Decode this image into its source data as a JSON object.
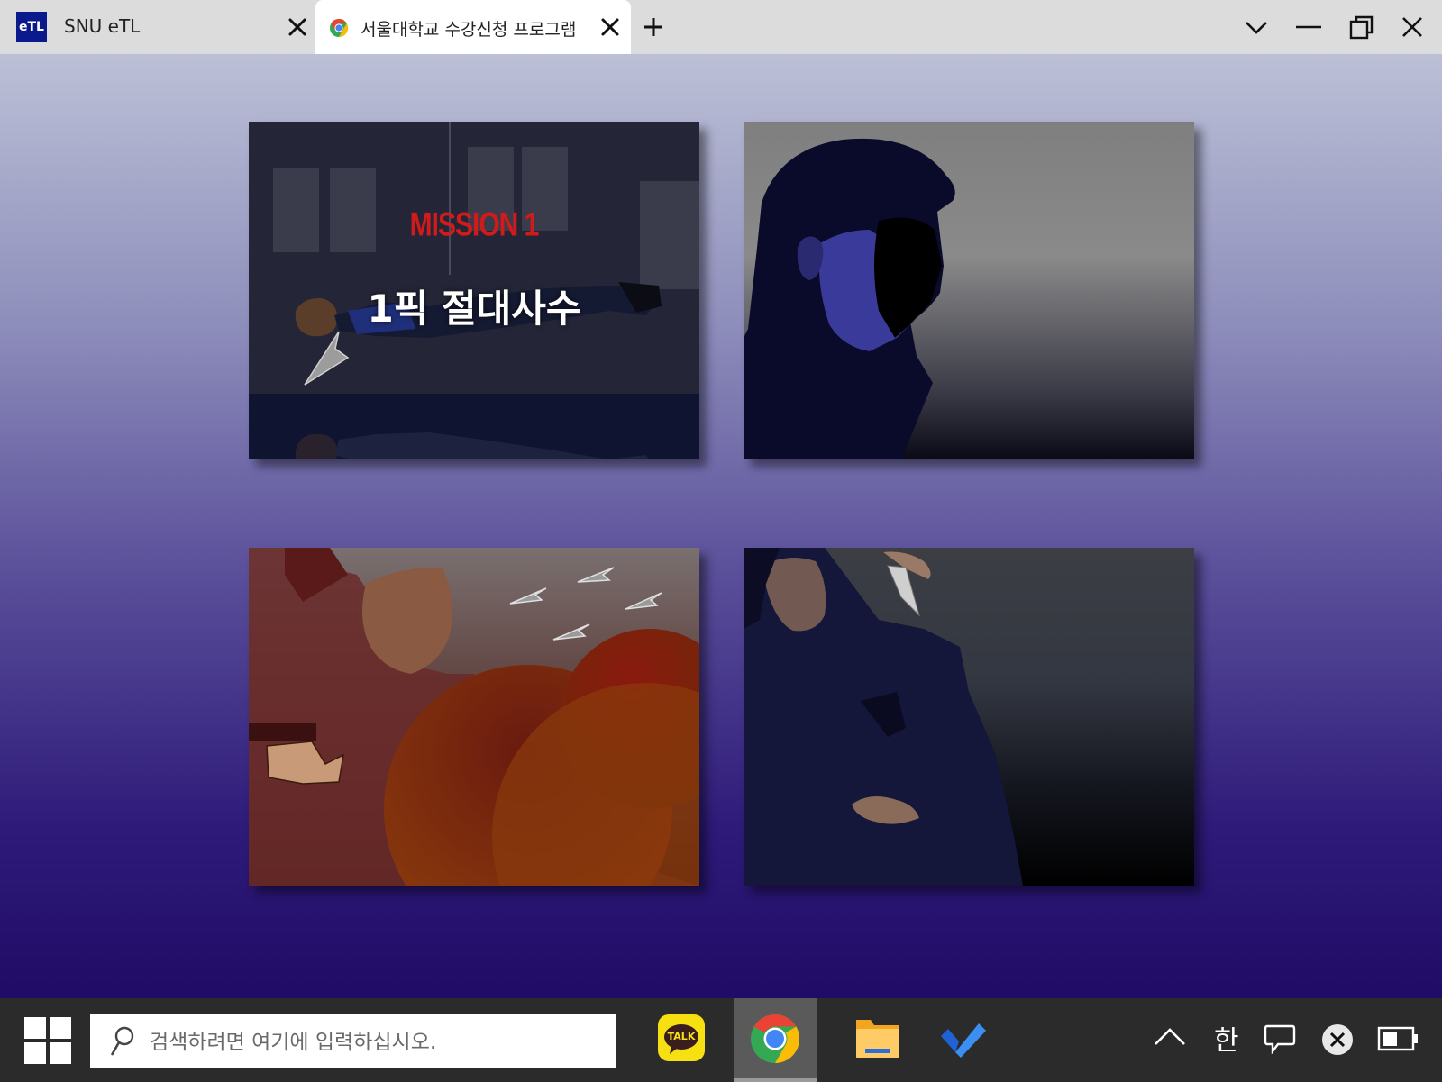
{
  "tabs": [
    {
      "logo_text": "eTL",
      "label": "SNU eTL",
      "active": false
    },
    {
      "label": "서울대학교 수강신청 프로그램",
      "active": true
    }
  ],
  "window_controls": [
    "chevron-down",
    "minimize",
    "restore",
    "close"
  ],
  "panels": [
    {
      "mission_label": "MISSION 1",
      "title": "1픽 절대사수"
    },
    {
      "scene": "silhouette"
    },
    {
      "scene": "arrows"
    },
    {
      "scene": "hooded"
    }
  ],
  "taskbar": {
    "search_placeholder": "검색하려면 여기에 입력하십시오.",
    "apps": [
      "kakaotalk",
      "chrome",
      "file-explorer",
      "todo"
    ],
    "kakao_label": "TALK",
    "ime_label": "한"
  },
  "colors": {
    "accent_red": "#d11a1a",
    "etl_blue": "#0a1a8c",
    "taskbar": "#2b2b2b",
    "tabbar": "#dcdcdc"
  }
}
